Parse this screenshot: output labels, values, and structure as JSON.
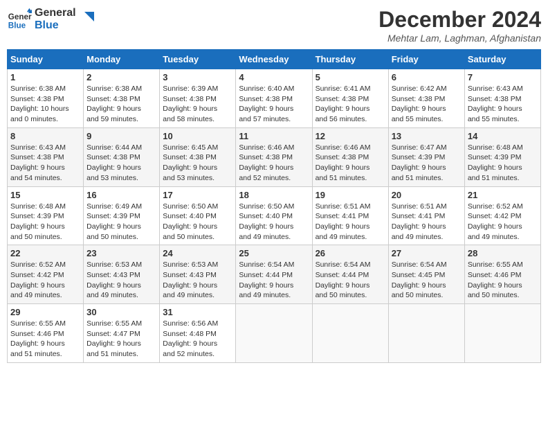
{
  "header": {
    "logo_line1": "General",
    "logo_line2": "Blue",
    "month_title": "December 2024",
    "location": "Mehtar Lam, Laghman, Afghanistan"
  },
  "weekdays": [
    "Sunday",
    "Monday",
    "Tuesday",
    "Wednesday",
    "Thursday",
    "Friday",
    "Saturday"
  ],
  "weeks": [
    [
      {
        "day": "1",
        "sunrise": "6:38 AM",
        "sunset": "4:38 PM",
        "daylight": "10 hours and 0 minutes."
      },
      {
        "day": "2",
        "sunrise": "6:38 AM",
        "sunset": "4:38 PM",
        "daylight": "9 hours and 59 minutes."
      },
      {
        "day": "3",
        "sunrise": "6:39 AM",
        "sunset": "4:38 PM",
        "daylight": "9 hours and 58 minutes."
      },
      {
        "day": "4",
        "sunrise": "6:40 AM",
        "sunset": "4:38 PM",
        "daylight": "9 hours and 57 minutes."
      },
      {
        "day": "5",
        "sunrise": "6:41 AM",
        "sunset": "4:38 PM",
        "daylight": "9 hours and 56 minutes."
      },
      {
        "day": "6",
        "sunrise": "6:42 AM",
        "sunset": "4:38 PM",
        "daylight": "9 hours and 55 minutes."
      },
      {
        "day": "7",
        "sunrise": "6:43 AM",
        "sunset": "4:38 PM",
        "daylight": "9 hours and 55 minutes."
      }
    ],
    [
      {
        "day": "8",
        "sunrise": "6:43 AM",
        "sunset": "4:38 PM",
        "daylight": "9 hours and 54 minutes."
      },
      {
        "day": "9",
        "sunrise": "6:44 AM",
        "sunset": "4:38 PM",
        "daylight": "9 hours and 53 minutes."
      },
      {
        "day": "10",
        "sunrise": "6:45 AM",
        "sunset": "4:38 PM",
        "daylight": "9 hours and 53 minutes."
      },
      {
        "day": "11",
        "sunrise": "6:46 AM",
        "sunset": "4:38 PM",
        "daylight": "9 hours and 52 minutes."
      },
      {
        "day": "12",
        "sunrise": "6:46 AM",
        "sunset": "4:38 PM",
        "daylight": "9 hours and 51 minutes."
      },
      {
        "day": "13",
        "sunrise": "6:47 AM",
        "sunset": "4:39 PM",
        "daylight": "9 hours and 51 minutes."
      },
      {
        "day": "14",
        "sunrise": "6:48 AM",
        "sunset": "4:39 PM",
        "daylight": "9 hours and 51 minutes."
      }
    ],
    [
      {
        "day": "15",
        "sunrise": "6:48 AM",
        "sunset": "4:39 PM",
        "daylight": "9 hours and 50 minutes."
      },
      {
        "day": "16",
        "sunrise": "6:49 AM",
        "sunset": "4:39 PM",
        "daylight": "9 hours and 50 minutes."
      },
      {
        "day": "17",
        "sunrise": "6:50 AM",
        "sunset": "4:40 PM",
        "daylight": "9 hours and 50 minutes."
      },
      {
        "day": "18",
        "sunrise": "6:50 AM",
        "sunset": "4:40 PM",
        "daylight": "9 hours and 49 minutes."
      },
      {
        "day": "19",
        "sunrise": "6:51 AM",
        "sunset": "4:41 PM",
        "daylight": "9 hours and 49 minutes."
      },
      {
        "day": "20",
        "sunrise": "6:51 AM",
        "sunset": "4:41 PM",
        "daylight": "9 hours and 49 minutes."
      },
      {
        "day": "21",
        "sunrise": "6:52 AM",
        "sunset": "4:42 PM",
        "daylight": "9 hours and 49 minutes."
      }
    ],
    [
      {
        "day": "22",
        "sunrise": "6:52 AM",
        "sunset": "4:42 PM",
        "daylight": "9 hours and 49 minutes."
      },
      {
        "day": "23",
        "sunrise": "6:53 AM",
        "sunset": "4:43 PM",
        "daylight": "9 hours and 49 minutes."
      },
      {
        "day": "24",
        "sunrise": "6:53 AM",
        "sunset": "4:43 PM",
        "daylight": "9 hours and 49 minutes."
      },
      {
        "day": "25",
        "sunrise": "6:54 AM",
        "sunset": "4:44 PM",
        "daylight": "9 hours and 49 minutes."
      },
      {
        "day": "26",
        "sunrise": "6:54 AM",
        "sunset": "4:44 PM",
        "daylight": "9 hours and 50 minutes."
      },
      {
        "day": "27",
        "sunrise": "6:54 AM",
        "sunset": "4:45 PM",
        "daylight": "9 hours and 50 minutes."
      },
      {
        "day": "28",
        "sunrise": "6:55 AM",
        "sunset": "4:46 PM",
        "daylight": "9 hours and 50 minutes."
      }
    ],
    [
      {
        "day": "29",
        "sunrise": "6:55 AM",
        "sunset": "4:46 PM",
        "daylight": "9 hours and 51 minutes."
      },
      {
        "day": "30",
        "sunrise": "6:55 AM",
        "sunset": "4:47 PM",
        "daylight": "9 hours and 51 minutes."
      },
      {
        "day": "31",
        "sunrise": "6:56 AM",
        "sunset": "4:48 PM",
        "daylight": "9 hours and 52 minutes."
      },
      null,
      null,
      null,
      null
    ]
  ],
  "labels": {
    "sunrise": "Sunrise:",
    "sunset": "Sunset:",
    "daylight": "Daylight:"
  }
}
